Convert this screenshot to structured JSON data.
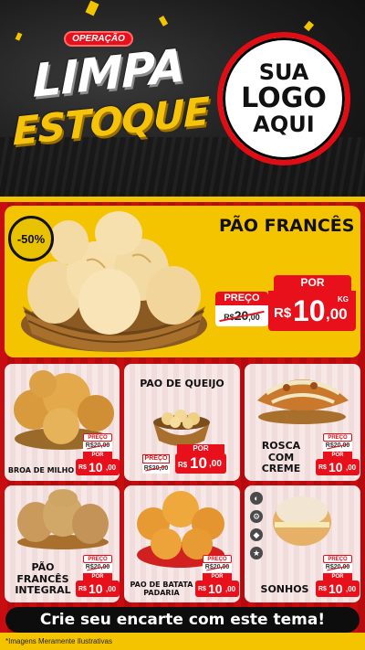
{
  "header": {
    "badge": "OPERAÇÃO",
    "title_line1": "LIMPA",
    "title_line2": "ESTOQUE",
    "logo": {
      "line1": "SUA",
      "line2": "LOGO",
      "line3": "AQUI"
    }
  },
  "featured": {
    "discount": "-50%",
    "name": "PÃO FRANCÊS",
    "preco_label": "PREÇO",
    "old_price_int": "20",
    "old_price_dec": ",00",
    "por_label": "POR",
    "currency": "R$",
    "price_int": "10",
    "price_dec": ",00",
    "unit": "KG"
  },
  "products": [
    {
      "name": "BROA DE MILHO",
      "preco_label": "PREÇO",
      "old": "R$20,00",
      "por_label": "POR",
      "currency": "R$",
      "price_int": "10",
      "price_dec": ",00",
      "unit": "KG"
    },
    {
      "name": "PAO DE QUEIJO",
      "preco_label": "PREÇO",
      "old": "R$20,00",
      "por_label": "POR",
      "currency": "R$",
      "price_int": "10",
      "price_dec": ",00",
      "unit": "KG"
    },
    {
      "name": "ROSCA COM CREME",
      "preco_label": "PREÇO",
      "old": "R$20,00",
      "por_label": "POR",
      "currency": "R$",
      "price_int": "10",
      "price_dec": ",00",
      "unit": "KG"
    },
    {
      "name": "PÃO FRANCÊS INTEGRAL",
      "preco_label": "PREÇO",
      "old": "R$20,00",
      "por_label": "POR",
      "currency": "R$",
      "price_int": "10",
      "price_dec": ",00",
      "unit": "KG"
    },
    {
      "name": "PAO DE BATATA PADARIA",
      "preco_label": "PREÇO",
      "old": "R$20,00",
      "por_label": "POR",
      "currency": "R$",
      "price_int": "10",
      "price_dec": ",00",
      "unit": "KG"
    },
    {
      "name": "SONHOS",
      "preco_label": "PREÇO",
      "old": "R$20,00",
      "por_label": "POR",
      "currency": "R$",
      "price_int": "10",
      "price_dec": ",00",
      "unit": "KG"
    }
  ],
  "side_tools": [
    "palette-icon",
    "gear-icon",
    "tag-icon",
    "star-icon"
  ],
  "cta": "Crie seu encarte com este tema!",
  "footnote": "*Imagens Meramente Ilustrativas",
  "colors": {
    "red": "#e8101a",
    "yellow": "#f5c400",
    "dark": "#0d0d0d",
    "card": "#f3e3e2"
  }
}
